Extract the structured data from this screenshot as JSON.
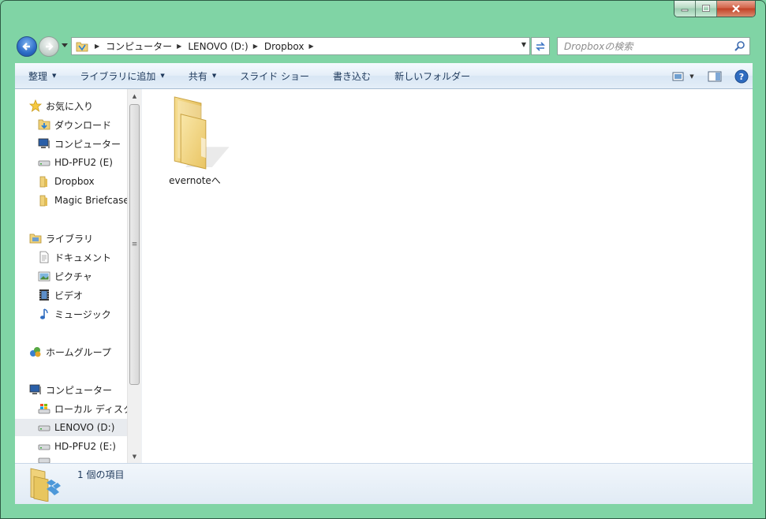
{
  "window": {
    "accent_color": "#80d4a5",
    "caption_buttons": [
      "minimize-icon",
      "maximize-icon",
      "close-icon"
    ]
  },
  "address": {
    "breadcrumbs": [
      "コンピューター",
      "LENOVO (D:)",
      "Dropbox"
    ]
  },
  "search": {
    "placeholder": "Dropboxの検索"
  },
  "toolbar": {
    "organize": "整理",
    "add_to_library": "ライブラリに追加",
    "share": "共有",
    "slideshow": "スライド ショー",
    "burn": "書き込む",
    "new_folder": "新しいフォルダー"
  },
  "sidebar": {
    "favorites": {
      "label": "お気に入り",
      "items": [
        {
          "label": "ダウンロード",
          "icon": "downloads-folder-icon"
        },
        {
          "label": "コンピューター",
          "icon": "computer-icon"
        },
        {
          "label": "HD-PFU2 (E)",
          "icon": "drive-icon"
        },
        {
          "label": "Dropbox",
          "icon": "folder-icon"
        },
        {
          "label": "Magic Briefcase",
          "icon": "folder-icon"
        }
      ]
    },
    "libraries": {
      "label": "ライブラリ",
      "items": [
        {
          "label": "ドキュメント",
          "icon": "document-icon"
        },
        {
          "label": "ピクチャ",
          "icon": "picture-icon"
        },
        {
          "label": "ビデオ",
          "icon": "video-icon"
        },
        {
          "label": "ミュージック",
          "icon": "music-icon"
        }
      ]
    },
    "homegroup": {
      "label": "ホームグループ"
    },
    "computer": {
      "label": "コンピューター",
      "items": [
        {
          "label": "ローカル ディスク",
          "icon": "local-disk-icon"
        },
        {
          "label": "LENOVO (D:)",
          "icon": "drive-icon",
          "selected": true
        },
        {
          "label": "HD-PFU2 (E:)",
          "icon": "drive-icon"
        }
      ]
    }
  },
  "files": [
    {
      "name": "evernoteへ",
      "icon": "folder-icon"
    }
  ],
  "details": {
    "item_count": "1 個の項目"
  }
}
